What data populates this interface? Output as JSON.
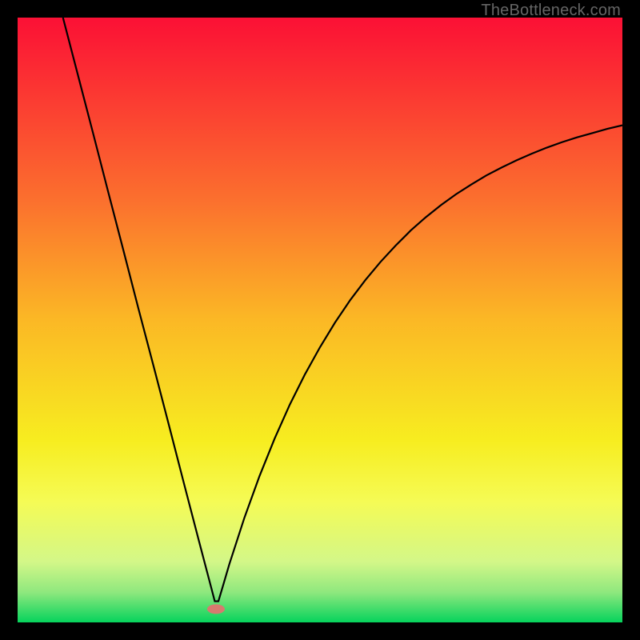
{
  "watermark": "TheBottleneck.com",
  "chart_data": {
    "type": "line",
    "title": "",
    "xlabel": "",
    "ylabel": "",
    "xlim": [
      0,
      100
    ],
    "ylim": [
      0,
      100
    ],
    "grid": false,
    "legend": false,
    "background_gradient": {
      "stops": [
        {
          "pos": 0.0,
          "color": "#fb1035"
        },
        {
          "pos": 0.3,
          "color": "#fb6f2e"
        },
        {
          "pos": 0.5,
          "color": "#fbb825"
        },
        {
          "pos": 0.7,
          "color": "#f7ed20"
        },
        {
          "pos": 0.8,
          "color": "#f5fb55"
        },
        {
          "pos": 0.9,
          "color": "#d3f788"
        },
        {
          "pos": 0.95,
          "color": "#8fe87e"
        },
        {
          "pos": 1.0,
          "color": "#06d35c"
        }
      ]
    },
    "marker": {
      "x": 32.8,
      "y": 2.2,
      "color": "#d77a6f"
    },
    "series": [
      {
        "name": "bottleneck-curve",
        "color": "#000000",
        "x": [
          7.5,
          10,
          12.5,
          15,
          17.5,
          20,
          22.5,
          25,
          27.5,
          30,
          31,
          32,
          32.6,
          33.2,
          34,
          35,
          37.5,
          40,
          42.5,
          45,
          47.5,
          50,
          52.5,
          55,
          57.5,
          60,
          62.5,
          65,
          67.5,
          70,
          72.5,
          75,
          77.5,
          80,
          82.5,
          85,
          87.5,
          90,
          92.5,
          95,
          97.5,
          100
        ],
        "y": [
          100,
          90.4,
          80.8,
          71.1,
          61.5,
          51.8,
          42.3,
          32.7,
          23.0,
          13.4,
          9.6,
          5.8,
          3.5,
          3.5,
          6.2,
          9.6,
          17.3,
          24.2,
          30.4,
          36.0,
          41.0,
          45.5,
          49.6,
          53.3,
          56.6,
          59.6,
          62.3,
          64.8,
          67.0,
          69.0,
          70.8,
          72.4,
          73.9,
          75.2,
          76.4,
          77.5,
          78.5,
          79.4,
          80.2,
          80.9,
          81.6,
          82.2
        ]
      }
    ]
  }
}
